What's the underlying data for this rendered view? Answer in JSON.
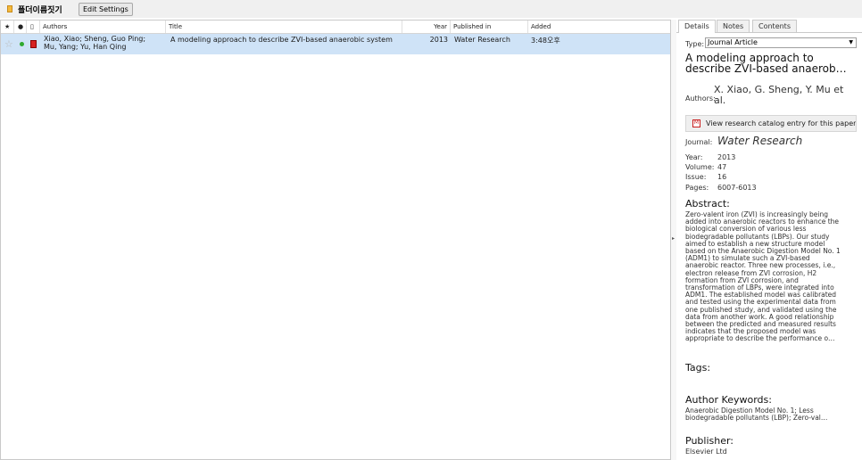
{
  "toolbar": {
    "folder_name": "폴더이름짓기",
    "edit_settings_label": "Edit Settings"
  },
  "columns": {
    "star": "★",
    "read": "●",
    "file": "▯",
    "authors": "Authors",
    "title": "Title",
    "year": "Year",
    "published_in": "Published in",
    "added": "Added"
  },
  "rows": [
    {
      "authors_line1": "Xiao, Xiao; Sheng, Guo Ping;",
      "authors_line2": "Mu, Yang; Yu, Han Qing",
      "title": "A modeling approach to describe ZVI-based anaerobic system",
      "year": "2013",
      "published_in": "Water Research",
      "added": "3:48오후",
      "star": "☆",
      "read_color": "#2faa2f"
    }
  ],
  "details": {
    "tabs": [
      "Details",
      "Notes",
      "Contents"
    ],
    "type_label": "Type:",
    "type_value": "Journal Article",
    "title": "A modeling approach to describe ZVI-based anaerob…",
    "authors_label": "Authors:",
    "authors": "X. Xiao, G. Sheng, Y. Mu et al.",
    "catalog_button": "View research catalog entry for this paper",
    "journal_label": "Journal:",
    "journal": "Water Research",
    "year_label": "Year:",
    "year": "2013",
    "volume_label": "Volume:",
    "volume": "47",
    "issue_label": "Issue:",
    "issue": "16",
    "pages_label": "Pages:",
    "pages": "6007-6013",
    "abstract_heading": "Abstract:",
    "abstract": "Zero-valent iron (ZVI) is increasingly being added into anaerobic reactors to enhance the biological conversion of various less biodegradable pollutants (LBPs). Our study aimed to establish a new structure model based on the Anaerobic Digestion Model No. 1 (ADM1) to simulate such a ZVI-based anaerobic reactor. Three new processes, i.e., electron release from ZVI corrosion, H2 formation from ZVI corrosion, and transformation of LBPs, were integrated into ADM1. The established model was calibrated and tested using the experimental data from one published study, and validated using the data from another work. A good relationship between the predicted and measured results indicates that the proposed model was appropriate to describe the performance o…",
    "tags_heading": "Tags:",
    "keywords_heading": "Author Keywords:",
    "keywords": "Anaerobic Digestion Model No. 1; Less biodegradable pollutants (LBP); Zero-val…",
    "publisher_heading": "Publisher:",
    "publisher": "Elsevier Ltd"
  }
}
